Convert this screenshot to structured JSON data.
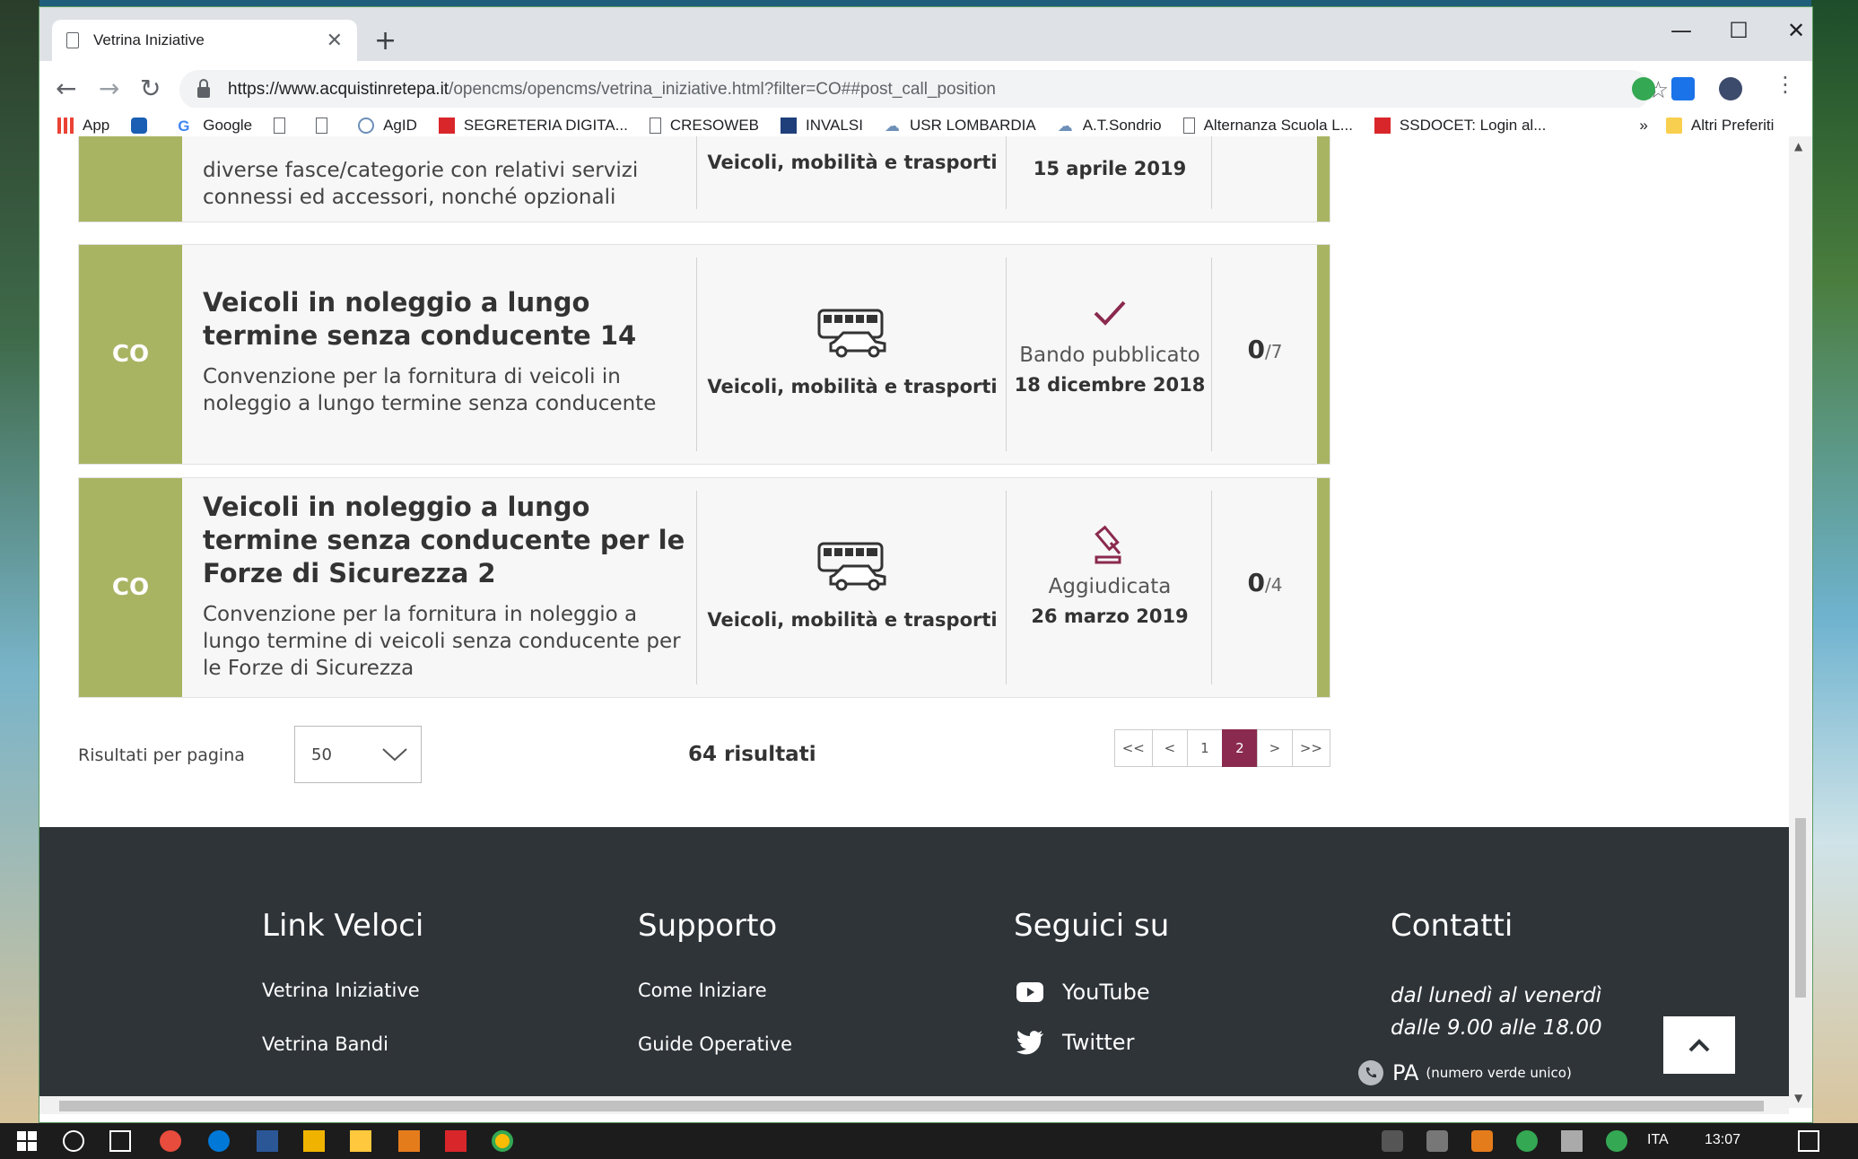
{
  "browser": {
    "tab_title": "Vetrina Iniziative",
    "url_host": "https://www.acquistinretepa.it",
    "url_path": "/opencms/opencms/vetrina_iniziative.html?filter=CO##post_call_position",
    "bookmarks": [
      {
        "label": "App",
        "color": "#4285f4"
      },
      {
        "label": "",
        "color": "#1a5fb4"
      },
      {
        "label": "Google",
        "color": "#4285f4"
      },
      {
        "label": "",
        "color": "#5f6368"
      },
      {
        "label": "",
        "color": "#5f6368"
      },
      {
        "label": "AgID",
        "color": "#6d8fb8"
      },
      {
        "label": "SEGRETERIA DIGITA...",
        "color": "#d9262b"
      },
      {
        "label": "CRESOWEB",
        "color": "#5f6368"
      },
      {
        "label": "INVALSI",
        "color": "#1e3f7a"
      },
      {
        "label": "USR LOMBARDIA",
        "color": "#6d8fb8"
      },
      {
        "label": "A.T.Sondrio",
        "color": "#6d8fb8"
      },
      {
        "label": "Alternanza Scuola L...",
        "color": "#5f6368"
      },
      {
        "label": "SSDOCET: Login al...",
        "color": "#d9262b"
      }
    ],
    "more_bookmarks": "»",
    "other_bookmarks": "Altri Preferiti"
  },
  "cards": [
    {
      "code": "",
      "title": "",
      "description": "diverse fasce/categorie con relativi servizi connessi ed accessori, nonché opzionali",
      "category": "Veicoli, mobilità e trasporti",
      "status": "",
      "date": "15 aprile 2019",
      "count": "",
      "total": ""
    },
    {
      "code": "CO",
      "title": "Veicoli in noleggio a lungo termine senza conducente 14",
      "description": "Convenzione per la fornitura di veicoli in noleggio a lungo termine senza conducente",
      "category": "Veicoli, mobilità e trasporti",
      "status": "Bando pubblicato",
      "status_icon": "check-icon",
      "date": "18 dicembre 2018",
      "count": "0",
      "total": "/7"
    },
    {
      "code": "CO",
      "title": "Veicoli in noleggio a lungo termine senza conducente per le Forze di Sicurezza 2",
      "description": "Convenzione per la fornitura in noleggio a lungo termine di veicoli senza conducente per le Forze di Sicurezza",
      "category": "Veicoli, mobilità e trasporti",
      "status": "Aggiudicata",
      "status_icon": "gavel-icon",
      "date": "26 marzo 2019",
      "count": "0",
      "total": "/4"
    }
  ],
  "pagination": {
    "per_page_label": "Risultati per pagina",
    "per_page_value": "50",
    "results": "64 risultati",
    "pages": [
      "<<",
      "<",
      "1",
      "2",
      ">",
      ">>"
    ],
    "current": "2"
  },
  "footer": {
    "link_veloci": {
      "heading": "Link Veloci",
      "links": [
        "Vetrina Iniziative",
        "Vetrina Bandi"
      ]
    },
    "supporto": {
      "heading": "Supporto",
      "links": [
        "Come Iniziare",
        "Guide Operative"
      ]
    },
    "seguici": {
      "heading": "Seguici su",
      "links": [
        "YouTube",
        "Twitter"
      ]
    },
    "contatti": {
      "heading": "Contatti",
      "hours_1": "dal lunedì al venerdì",
      "hours_2": "dalle 9.00 alle 18.00",
      "phone": "PA",
      "phone_note": "(numero verde unico)"
    }
  },
  "taskbar": {
    "language": "ITA",
    "time": "13:07"
  },
  "colors": {
    "accent_green": "#a9b463",
    "accent_maroon": "#8a2a4e",
    "footer_bg": "#2f3439"
  }
}
